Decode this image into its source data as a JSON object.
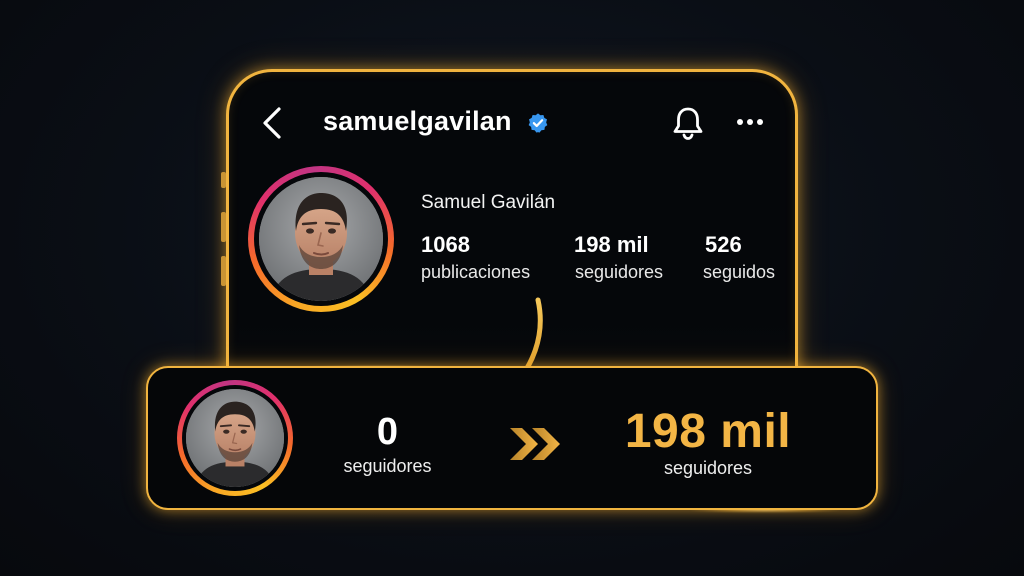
{
  "profile": {
    "username": "samuelgavilan",
    "full_name": "Samuel Gavilán",
    "verified": true,
    "stats": [
      {
        "value": "1068",
        "label": "publicaciones"
      },
      {
        "value": "198 mil",
        "label": "seguidores"
      },
      {
        "value": "526",
        "label": "seguidos"
      }
    ]
  },
  "header_icons": [
    "back-icon",
    "verified-icon",
    "bell-icon",
    "more-icon"
  ],
  "growth_card": {
    "from_value": "0",
    "from_label": "seguidores",
    "to_value": "198 mil",
    "to_label": "seguidores"
  },
  "colors": {
    "gold": "#f1b43f",
    "gold_text": "#f3b545",
    "verified_blue": "#3897f0",
    "background": "#0a0e15",
    "ring_gradient": [
      "#f9a825",
      "#f56a2b",
      "#e1306c",
      "#c13584"
    ]
  }
}
